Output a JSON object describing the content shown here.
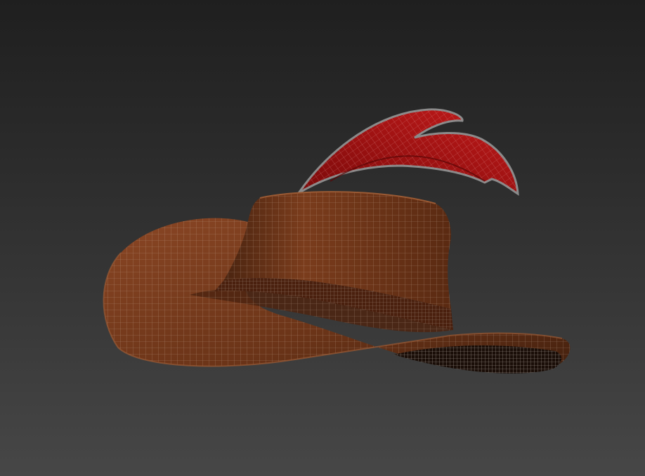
{
  "viewport": {
    "background_top": "#1f1f1f",
    "background_bottom": "#474747"
  },
  "model": {
    "object": "hat-with-feather",
    "display_mode": "shaded-wireframe",
    "colors": {
      "hat": "#6b3418",
      "hat_dark": "#3a1a0c",
      "hat_band": "#4a200e",
      "feather": "#b01414",
      "feather_dark": "#7a0a0a",
      "wire": "#cfb8a8",
      "feather_outline": "#8a8a8a",
      "brim_underside": "#1a0e08"
    }
  }
}
